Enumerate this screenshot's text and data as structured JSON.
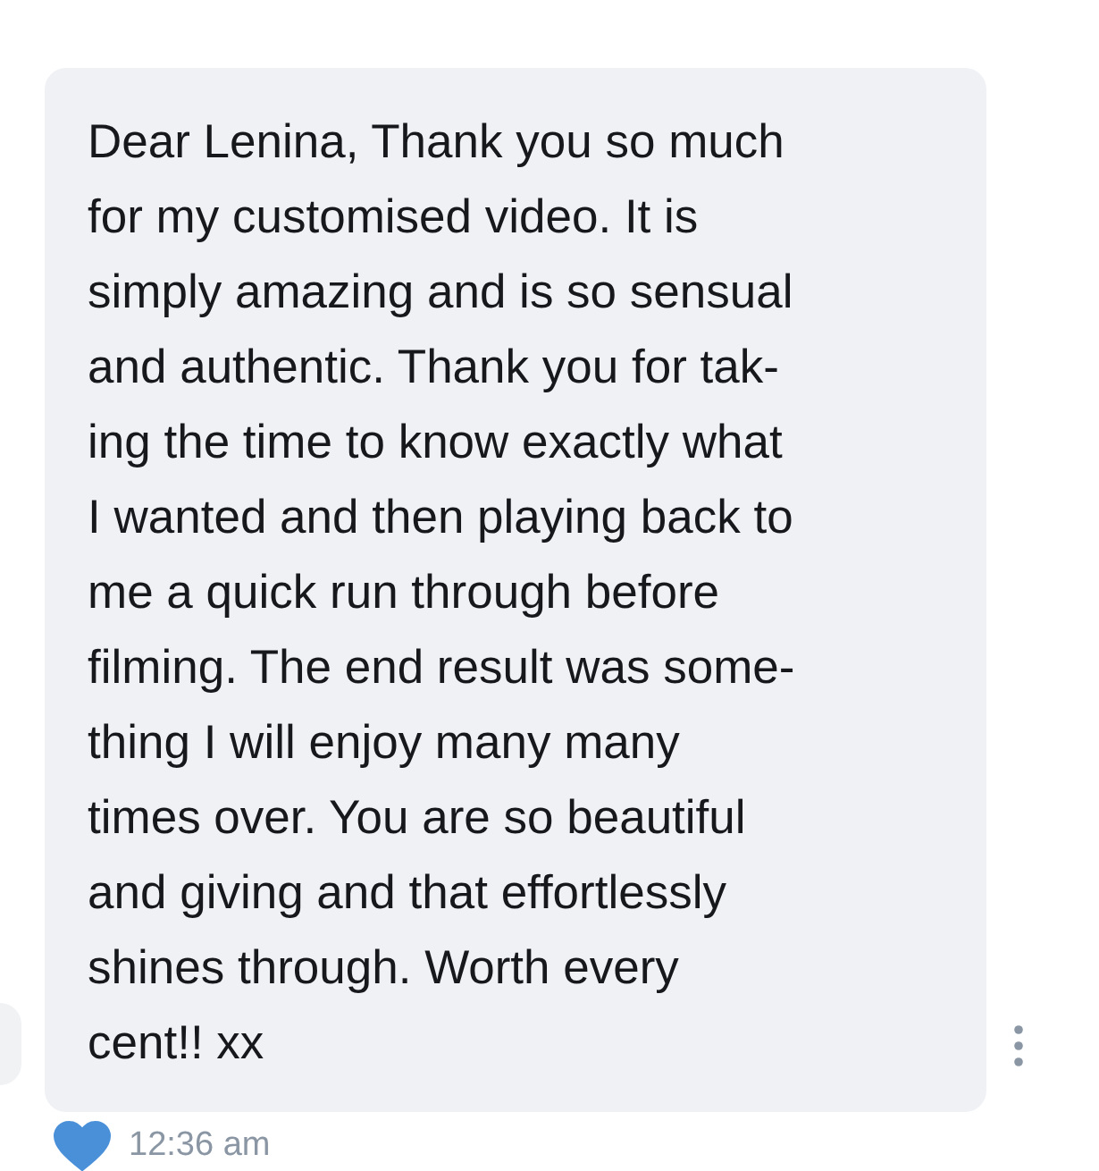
{
  "message": {
    "lines": [
      "Dear Lenina, Thank you so much",
      "for my customised video. It is",
      "simply amazing and is so sensual",
      "and authentic. Thank you for tak-",
      "ing the time to know exactly what",
      "I wanted and then playing back to",
      "me a quick run through before",
      "filming. The end result was some-",
      "thing I will enjoy many many",
      "times over. You are so beautiful",
      "and giving and that effortlessly",
      "shines through. Worth every",
      "cent!! xx"
    ],
    "liked": true,
    "time": "12:36 am"
  }
}
